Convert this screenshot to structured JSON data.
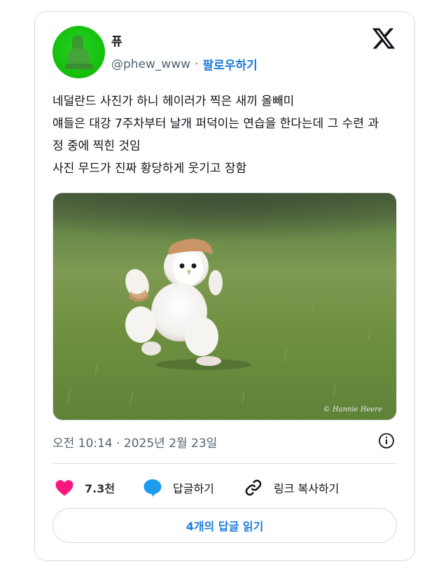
{
  "author": {
    "display_name": "퓨",
    "handle": "@phew_www",
    "separator": "·",
    "follow_label": "팔로우하기"
  },
  "tweet": {
    "lines": [
      "네덜란드 사진가 하니 헤이러가 찍은 새끼 올빼미",
      "얘들은 대강 7주차부터 날개 퍼덕이는 연습을 한다는데 그 수련 과",
      "정 중에 찍힌 것임",
      "사진 무드가 진짜 황당하게 웃기고 장함"
    ],
    "photo_watermark": "© Hannie Heere",
    "timestamp": "오전 10:14 · 2025년 2월 23일"
  },
  "actions": {
    "like_count": "7.3천",
    "reply_label": "답글하기",
    "copy_link_label": "링크 복사하기"
  },
  "read_replies_label": "4개의 답글 읽기",
  "icons": {
    "brand": "x-logo-icon",
    "info": "info-icon",
    "like": "heart-icon",
    "reply": "speech-bubble-icon",
    "copy": "link-icon"
  },
  "colors": {
    "accent": "#1d7bd8",
    "heart": "#f91880",
    "reply_bubble": "#1d9bf0",
    "avatar_green": "#17c10f"
  }
}
